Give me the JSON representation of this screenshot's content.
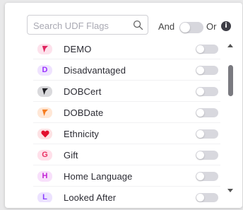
{
  "search": {
    "placeholder": "Search UDF Flags",
    "value": ""
  },
  "logic": {
    "and_label": "And",
    "or_label": "Or",
    "selected": "And"
  },
  "flags": [
    {
      "label": "DEMO",
      "badge_icon": "flag-icon",
      "badge_bg": "#fde2ec",
      "badge_color": "#e0245e",
      "enabled": false
    },
    {
      "label": "Disadvantaged",
      "badge_text": "D",
      "badge_bg": "#efe3ff",
      "badge_color": "#9b30ff",
      "enabled": false
    },
    {
      "label": "DOBCert",
      "badge_icon": "flag-icon",
      "badge_bg": "#d9d9dc",
      "badge_color": "#1d1d22",
      "enabled": false
    },
    {
      "label": "DOBDate",
      "badge_icon": "flag-icon",
      "badge_bg": "#ffe7d6",
      "badge_color": "#f57c1f",
      "enabled": false
    },
    {
      "label": "Ethnicity",
      "badge_icon": "heart-icon",
      "badge_bg": "#fde2e4",
      "badge_color": "#e3102e",
      "enabled": false
    },
    {
      "label": "Gift",
      "badge_text": "G",
      "badge_bg": "#ffe0ea",
      "badge_color": "#ea2f63",
      "enabled": false
    },
    {
      "label": "Home Language",
      "badge_text": "H",
      "badge_bg": "#f8e0fb",
      "badge_color": "#c323d6",
      "enabled": false
    },
    {
      "label": "Looked After",
      "badge_text": "L",
      "badge_bg": "#ece2ff",
      "badge_color": "#8a3cff",
      "enabled": false
    }
  ]
}
